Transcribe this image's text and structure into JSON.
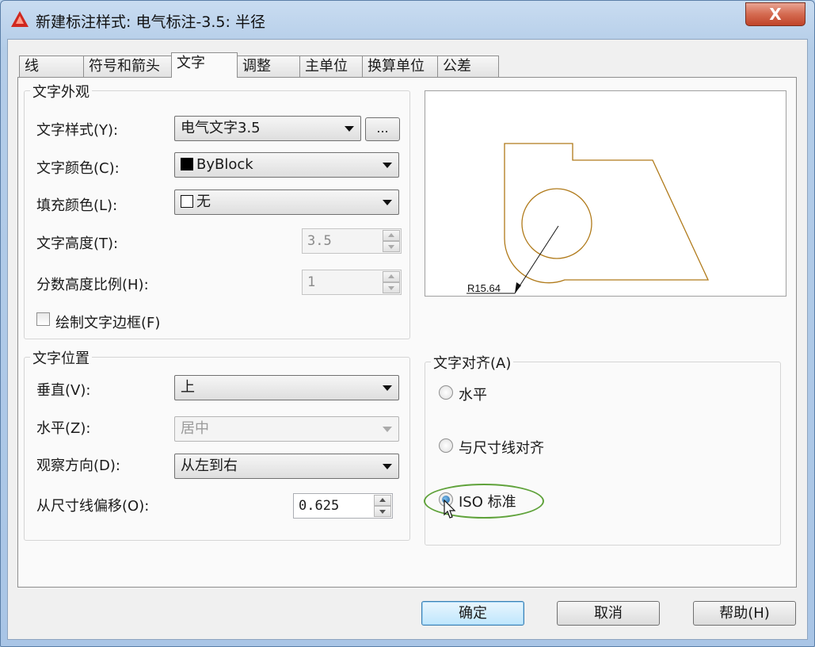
{
  "window": {
    "title": "新建标注样式: 电气标注-3.5: 半径",
    "close_label": "X",
    "accent": "#c0442a"
  },
  "tabs": [
    {
      "label": "线",
      "active": false
    },
    {
      "label": "符号和箭头",
      "active": false
    },
    {
      "label": "文字",
      "active": true
    },
    {
      "label": "调整",
      "active": false
    },
    {
      "label": "主单位",
      "active": false
    },
    {
      "label": "换算单位",
      "active": false
    },
    {
      "label": "公差",
      "active": false
    }
  ],
  "appearance": {
    "group_title": "文字外观",
    "text_style": {
      "label": "文字样式(Y):",
      "value": "电气文字3.5",
      "browse_label": "..."
    },
    "text_color": {
      "label": "文字颜色(C):",
      "value": "ByBlock",
      "swatch": "#000000"
    },
    "fill_color": {
      "label": "填充颜色(L):",
      "value": "无",
      "swatch": "#ffffff"
    },
    "text_height": {
      "label": "文字高度(T):",
      "value": "3.5"
    },
    "fraction_scale": {
      "label": "分数高度比例(H):",
      "value": "1"
    },
    "draw_frame": {
      "label": "绘制文字边框(F)",
      "checked": false
    }
  },
  "placement": {
    "group_title": "文字位置",
    "vertical": {
      "label": "垂直(V):",
      "value": "上"
    },
    "horizontal": {
      "label": "水平(Z):",
      "value": "居中"
    },
    "view_direction": {
      "label": "观察方向(D):",
      "value": "从左到右"
    },
    "offset": {
      "label": "从尺寸线偏移(O):",
      "value": "0.625"
    }
  },
  "preview": {
    "dimension_text": "R15.64",
    "line_color": "#b07a1a"
  },
  "alignment": {
    "group_title": "文字对齐(A)",
    "options": [
      {
        "label": "水平",
        "checked": false
      },
      {
        "label": "与尺寸线对齐",
        "checked": false
      },
      {
        "label": "ISO 标准",
        "checked": true
      }
    ],
    "highlight_color": "#5fa23a"
  },
  "buttons": {
    "ok": "确定",
    "cancel": "取消",
    "help": "帮助(H)"
  }
}
